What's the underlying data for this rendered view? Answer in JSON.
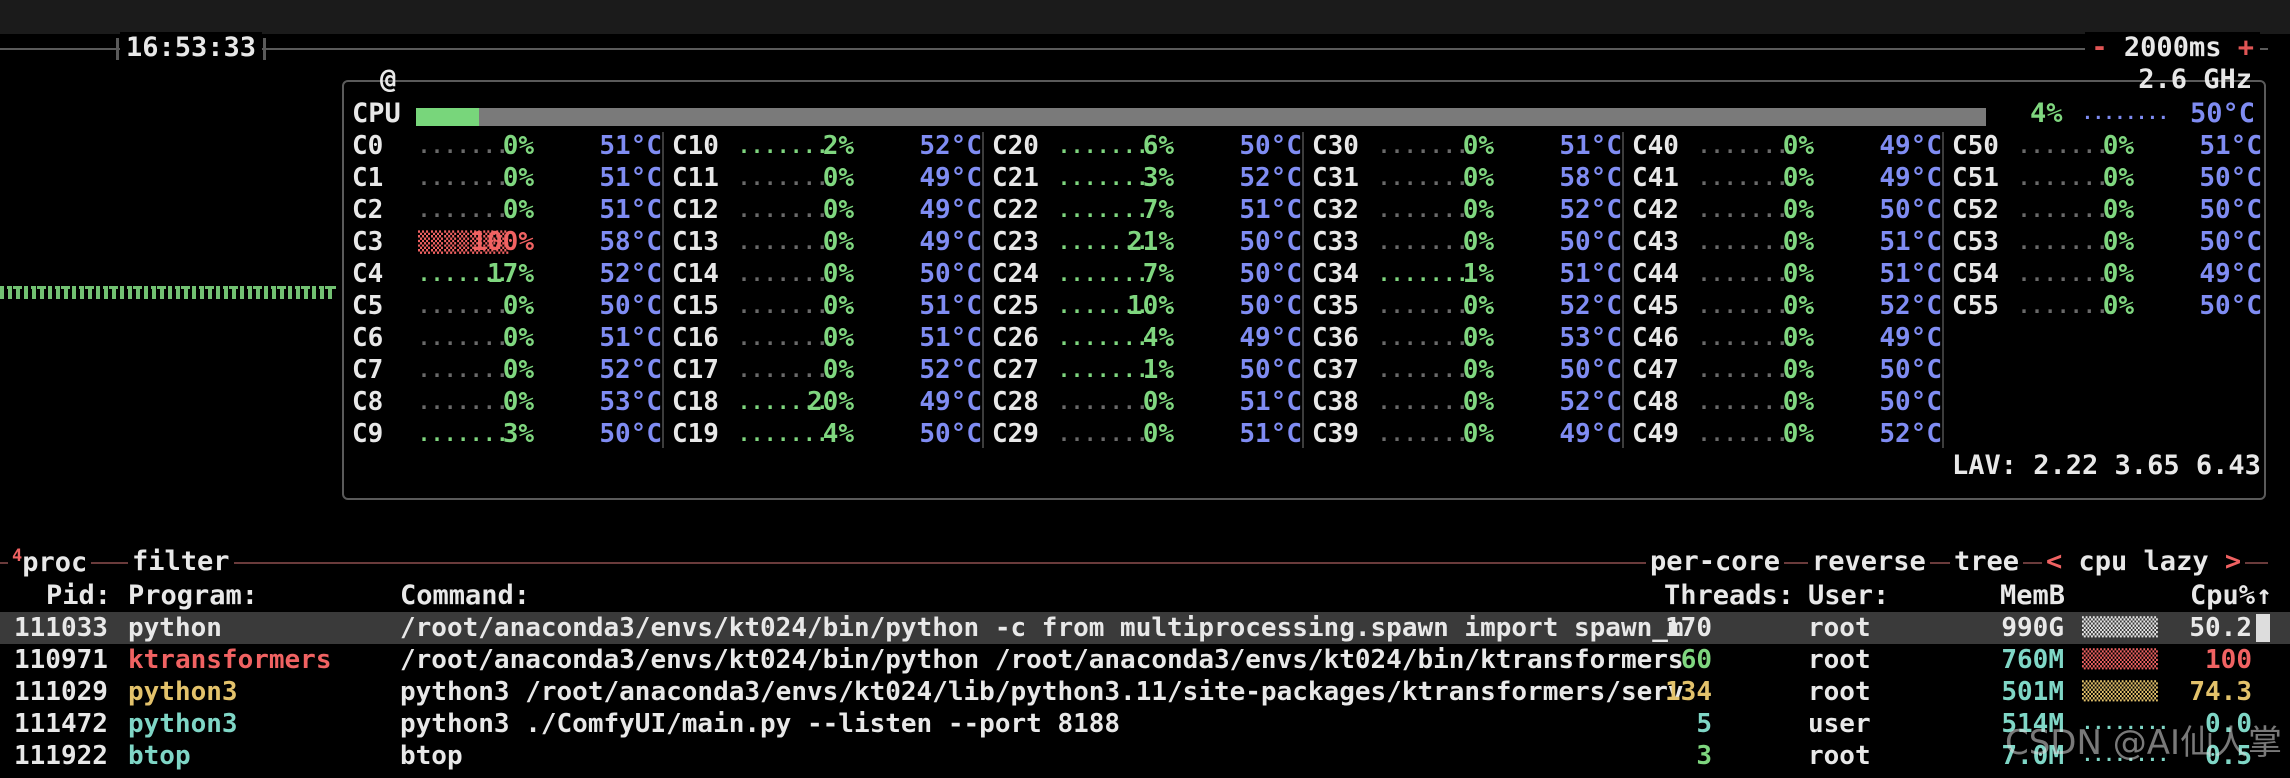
{
  "header": {
    "clock": "16:53:33",
    "interval_minus": "-",
    "interval": "2000ms",
    "interval_plus": "+",
    "freq": "2.6 GHz",
    "at_sign": "@"
  },
  "cpu": {
    "label": "CPU",
    "total_pct": "4%",
    "total_pct_value": 4,
    "total_temp": "50°C",
    "lav": "LAV: 2.22 3.65 6.43",
    "cores": [
      {
        "n": "C0",
        "p": "0%",
        "t": "51°C"
      },
      {
        "n": "C1",
        "p": "0%",
        "t": "51°C"
      },
      {
        "n": "C2",
        "p": "0%",
        "t": "51°C"
      },
      {
        "n": "C3",
        "p": "100%",
        "t": "58°C"
      },
      {
        "n": "C4",
        "p": "17%",
        "t": "52°C"
      },
      {
        "n": "C5",
        "p": "0%",
        "t": "50°C"
      },
      {
        "n": "C6",
        "p": "0%",
        "t": "51°C"
      },
      {
        "n": "C7",
        "p": "0%",
        "t": "52°C"
      },
      {
        "n": "C8",
        "p": "0%",
        "t": "53°C"
      },
      {
        "n": "C9",
        "p": "3%",
        "t": "50°C"
      },
      {
        "n": "C10",
        "p": "2%",
        "t": "52°C"
      },
      {
        "n": "C11",
        "p": "0%",
        "t": "49°C"
      },
      {
        "n": "C12",
        "p": "0%",
        "t": "49°C"
      },
      {
        "n": "C13",
        "p": "0%",
        "t": "49°C"
      },
      {
        "n": "C14",
        "p": "0%",
        "t": "50°C"
      },
      {
        "n": "C15",
        "p": "0%",
        "t": "51°C"
      },
      {
        "n": "C16",
        "p": "0%",
        "t": "51°C"
      },
      {
        "n": "C17",
        "p": "0%",
        "t": "52°C"
      },
      {
        "n": "C18",
        "p": "20%",
        "t": "49°C"
      },
      {
        "n": "C19",
        "p": "4%",
        "t": "50°C"
      },
      {
        "n": "C20",
        "p": "6%",
        "t": "50°C"
      },
      {
        "n": "C21",
        "p": "3%",
        "t": "52°C"
      },
      {
        "n": "C22",
        "p": "7%",
        "t": "51°C"
      },
      {
        "n": "C23",
        "p": "21%",
        "t": "50°C"
      },
      {
        "n": "C24",
        "p": "7%",
        "t": "50°C"
      },
      {
        "n": "C25",
        "p": "10%",
        "t": "50°C"
      },
      {
        "n": "C26",
        "p": "4%",
        "t": "49°C"
      },
      {
        "n": "C27",
        "p": "1%",
        "t": "50°C"
      },
      {
        "n": "C28",
        "p": "0%",
        "t": "51°C"
      },
      {
        "n": "C29",
        "p": "0%",
        "t": "51°C"
      },
      {
        "n": "C30",
        "p": "0%",
        "t": "51°C"
      },
      {
        "n": "C31",
        "p": "0%",
        "t": "58°C"
      },
      {
        "n": "C32",
        "p": "0%",
        "t": "52°C"
      },
      {
        "n": "C33",
        "p": "0%",
        "t": "50°C"
      },
      {
        "n": "C34",
        "p": "1%",
        "t": "51°C"
      },
      {
        "n": "C35",
        "p": "0%",
        "t": "52°C"
      },
      {
        "n": "C36",
        "p": "0%",
        "t": "53°C"
      },
      {
        "n": "C37",
        "p": "0%",
        "t": "50°C"
      },
      {
        "n": "C38",
        "p": "0%",
        "t": "52°C"
      },
      {
        "n": "C39",
        "p": "0%",
        "t": "49°C"
      },
      {
        "n": "C40",
        "p": "0%",
        "t": "49°C"
      },
      {
        "n": "C41",
        "p": "0%",
        "t": "49°C"
      },
      {
        "n": "C42",
        "p": "0%",
        "t": "50°C"
      },
      {
        "n": "C43",
        "p": "0%",
        "t": "51°C"
      },
      {
        "n": "C44",
        "p": "0%",
        "t": "51°C"
      },
      {
        "n": "C45",
        "p": "0%",
        "t": "52°C"
      },
      {
        "n": "C46",
        "p": "0%",
        "t": "49°C"
      },
      {
        "n": "C47",
        "p": "0%",
        "t": "50°C"
      },
      {
        "n": "C48",
        "p": "0%",
        "t": "50°C"
      },
      {
        "n": "C49",
        "p": "0%",
        "t": "52°C"
      },
      {
        "n": "C50",
        "p": "0%",
        "t": "51°C"
      },
      {
        "n": "C51",
        "p": "0%",
        "t": "50°C"
      },
      {
        "n": "C52",
        "p": "0%",
        "t": "50°C"
      },
      {
        "n": "C53",
        "p": "0%",
        "t": "50°C"
      },
      {
        "n": "C54",
        "p": "0%",
        "t": "49°C"
      },
      {
        "n": "C55",
        "p": "0%",
        "t": "50°C"
      }
    ]
  },
  "proc": {
    "tab_num": "4",
    "tab": "proc",
    "filter": "filter",
    "opt_percore": "per-core",
    "opt_reverse": "reverse",
    "opt_tree": "tree",
    "sort_left": "<",
    "sort": "cpu lazy",
    "sort_right": ">",
    "cols": {
      "pid": "Pid:",
      "program": "Program:",
      "command": "Command:",
      "threads": "Threads:",
      "user": "User:",
      "mem": "MemB",
      "cpu": "Cpu%",
      "arrow": "↑"
    },
    "rows": [
      {
        "pid": "111033",
        "program": "python",
        "command": "/root/anaconda3/envs/kt024/bin/python -c from multiprocessing.spawn import spawn_m",
        "threads": "170",
        "user": "root",
        "mem": "990G",
        "cpu": "50.2",
        "pc": "w"
      },
      {
        "pid": "110971",
        "program": "ktransformers",
        "command": "/root/anaconda3/envs/kt024/bin/python /root/anaconda3/envs/kt024/bin/ktransformers",
        "threads": "60",
        "user": "root",
        "mem": "760M",
        "cpu": "100",
        "pc": "r"
      },
      {
        "pid": "111029",
        "program": "python3",
        "command": "python3 /root/anaconda3/envs/kt024/lib/python3.11/site-packages/ktransformers/serv",
        "threads": "134",
        "user": "root",
        "mem": "501M",
        "cpu": "74.3",
        "pc": "y"
      },
      {
        "pid": "111472",
        "program": "python3",
        "command": "python3 ./ComfyUI/main.py --listen --port 8188",
        "threads": "5",
        "user": "user",
        "mem": "514M",
        "cpu": "0.0",
        "pc": "c"
      },
      {
        "pid": "111922",
        "program": "btop",
        "command": "btop",
        "threads": "3",
        "user": "root",
        "mem": "7.0M",
        "cpu": "0.5",
        "pc": "c"
      }
    ]
  },
  "watermark": "CSDN @AI仙人掌"
}
